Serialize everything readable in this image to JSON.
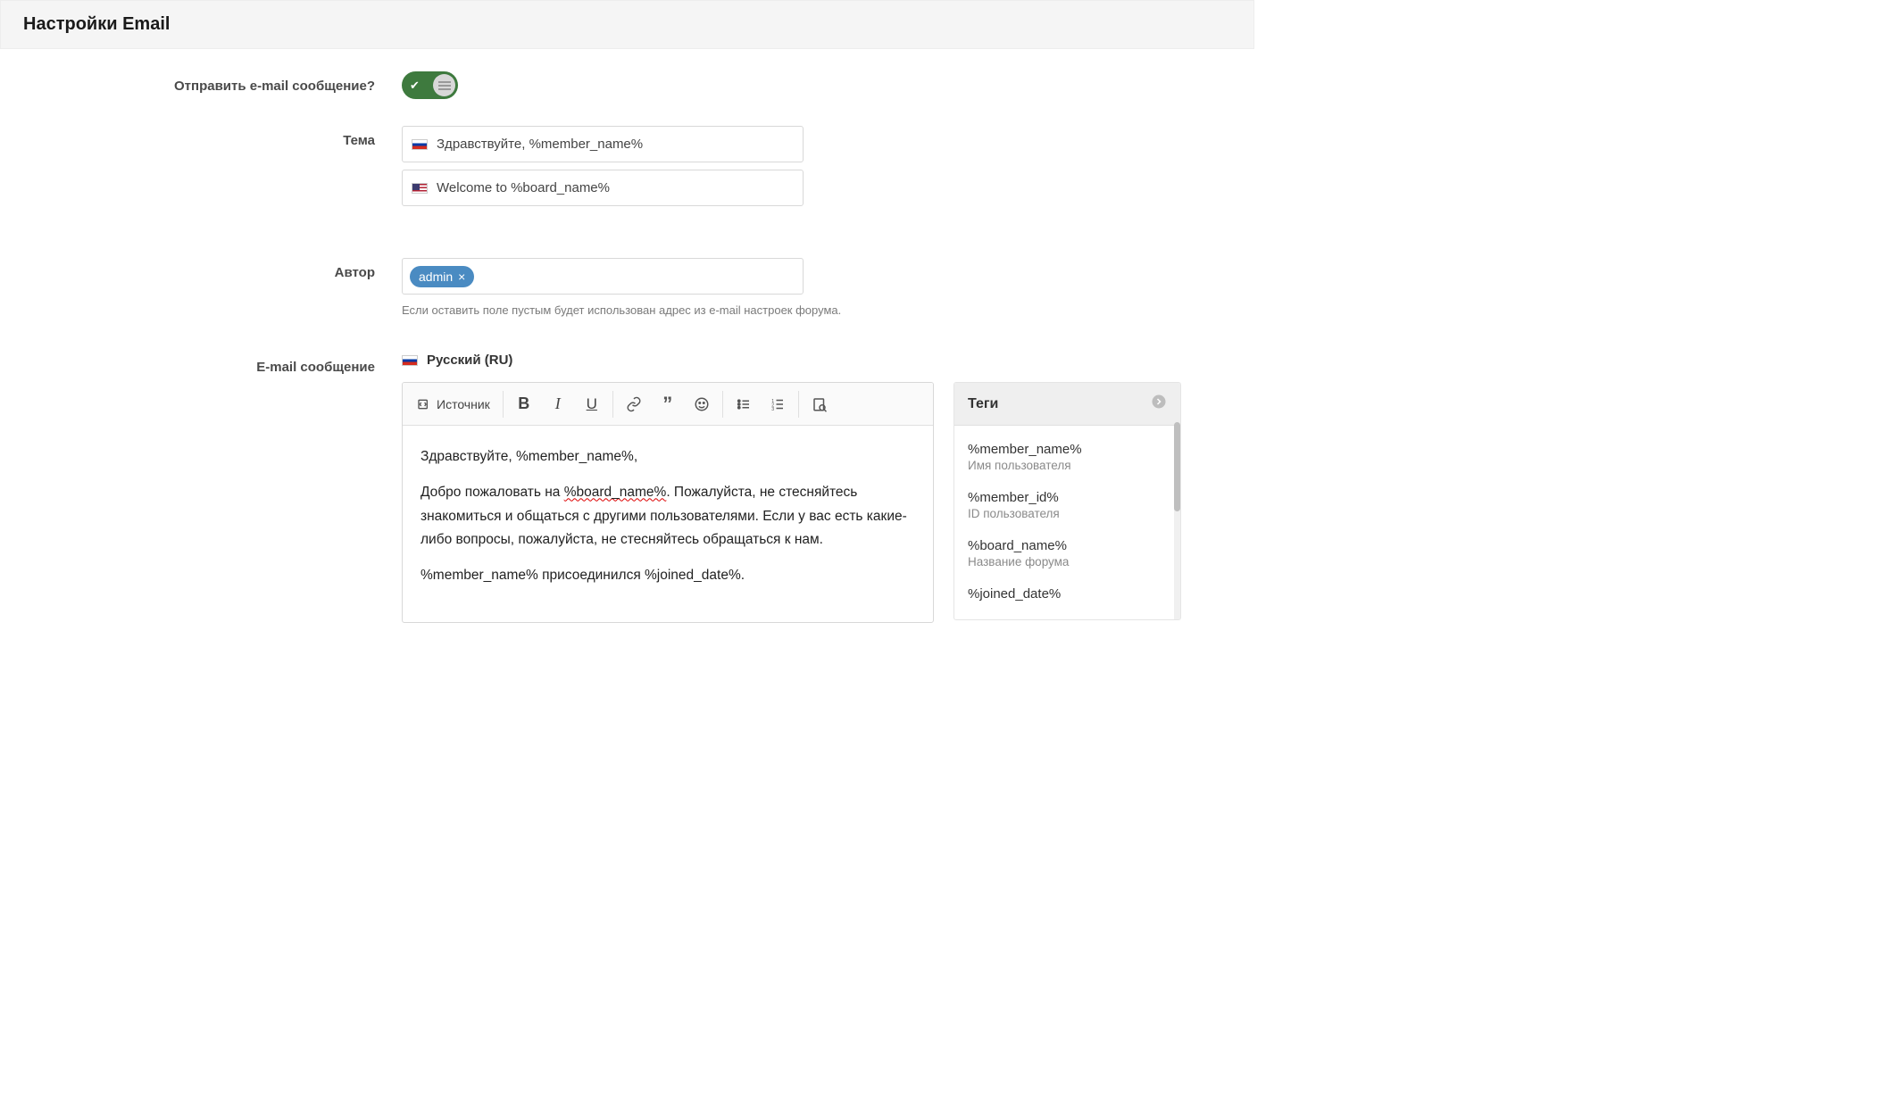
{
  "section": {
    "title": "Настройки Email"
  },
  "form": {
    "send_label": "Отправить e-mail сообщение?",
    "subject_label": "Тема",
    "subject_ru": "Здравствуйте, %member_name%",
    "subject_en": "Welcome to %board_name%",
    "author_label": "Автор",
    "author_tag": "admin",
    "author_remove": "×",
    "author_hint": "Если оставить поле пустым будет использован адрес из e-mail настроек форума.",
    "message_label": "E-mail сообщение",
    "message_lang": "Русский (RU)"
  },
  "toolbar": {
    "source": "Источник"
  },
  "editor": {
    "p1": "Здравствуйте, %member_name%,",
    "p2a": "Добро пожаловать на ",
    "p2b": "%board_name%",
    "p2c": ". Пожалуйста, не стесняйтесь знакомиться и общаться с другими пользователями. Если у вас есть какие-либо вопросы, пожалуйста, не стесняйтесь обращаться к нам.",
    "p3": "%member_name% присоединился %joined_date%."
  },
  "tags_panel": {
    "header": "Теги",
    "items": [
      {
        "key": "%member_name%",
        "desc": "Имя пользователя"
      },
      {
        "key": "%member_id%",
        "desc": "ID пользователя"
      },
      {
        "key": "%board_name%",
        "desc": "Название форума"
      },
      {
        "key": "%joined_date%",
        "desc": ""
      }
    ]
  }
}
